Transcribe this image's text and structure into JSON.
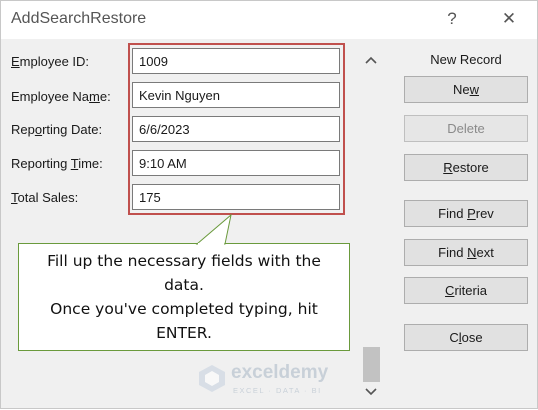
{
  "window": {
    "title": "AddSearchRestore",
    "help_glyph": "?",
    "close_glyph": "✕"
  },
  "fields": [
    {
      "label_pre": "",
      "label_acc": "E",
      "label_post": "mployee ID:",
      "value": "1009"
    },
    {
      "label_pre": "Employee Na",
      "label_acc": "m",
      "label_post": "e:",
      "value": "Kevin Nguyen"
    },
    {
      "label_pre": "Rep",
      "label_acc": "o",
      "label_post": "rting Date:",
      "value": "6/6/2023"
    },
    {
      "label_pre": "Reporting ",
      "label_acc": "T",
      "label_post": "ime:",
      "value": "9:10 AM"
    },
    {
      "label_pre": "",
      "label_acc": "T",
      "label_post": "otal Sales:",
      "value": "175"
    }
  ],
  "side_panel": {
    "record_status": "New Record",
    "buttons": [
      {
        "pre": "Ne",
        "acc": "w",
        "post": "",
        "enabled": true
      },
      {
        "pre": "Delete",
        "acc": "",
        "post": "",
        "enabled": false
      },
      {
        "pre": "",
        "acc": "R",
        "post": "estore",
        "enabled": true
      },
      {
        "pre": "Find ",
        "acc": "P",
        "post": "rev",
        "enabled": true
      },
      {
        "pre": "Find ",
        "acc": "N",
        "post": "ext",
        "enabled": true
      },
      {
        "pre": "",
        "acc": "C",
        "post": "riteria",
        "enabled": true
      },
      {
        "pre": "C",
        "acc": "l",
        "post": "ose",
        "enabled": true
      }
    ]
  },
  "callout": {
    "lines": [
      "Fill up the necessary fields with the",
      "data.",
      "Once you've completed typing, hit",
      "ENTER."
    ],
    "border_color": "#6a9a3c"
  },
  "highlight_color": "#c0504d",
  "watermark": {
    "name": "exceldemy",
    "tagline": "EXCEL · DATA · BI"
  }
}
